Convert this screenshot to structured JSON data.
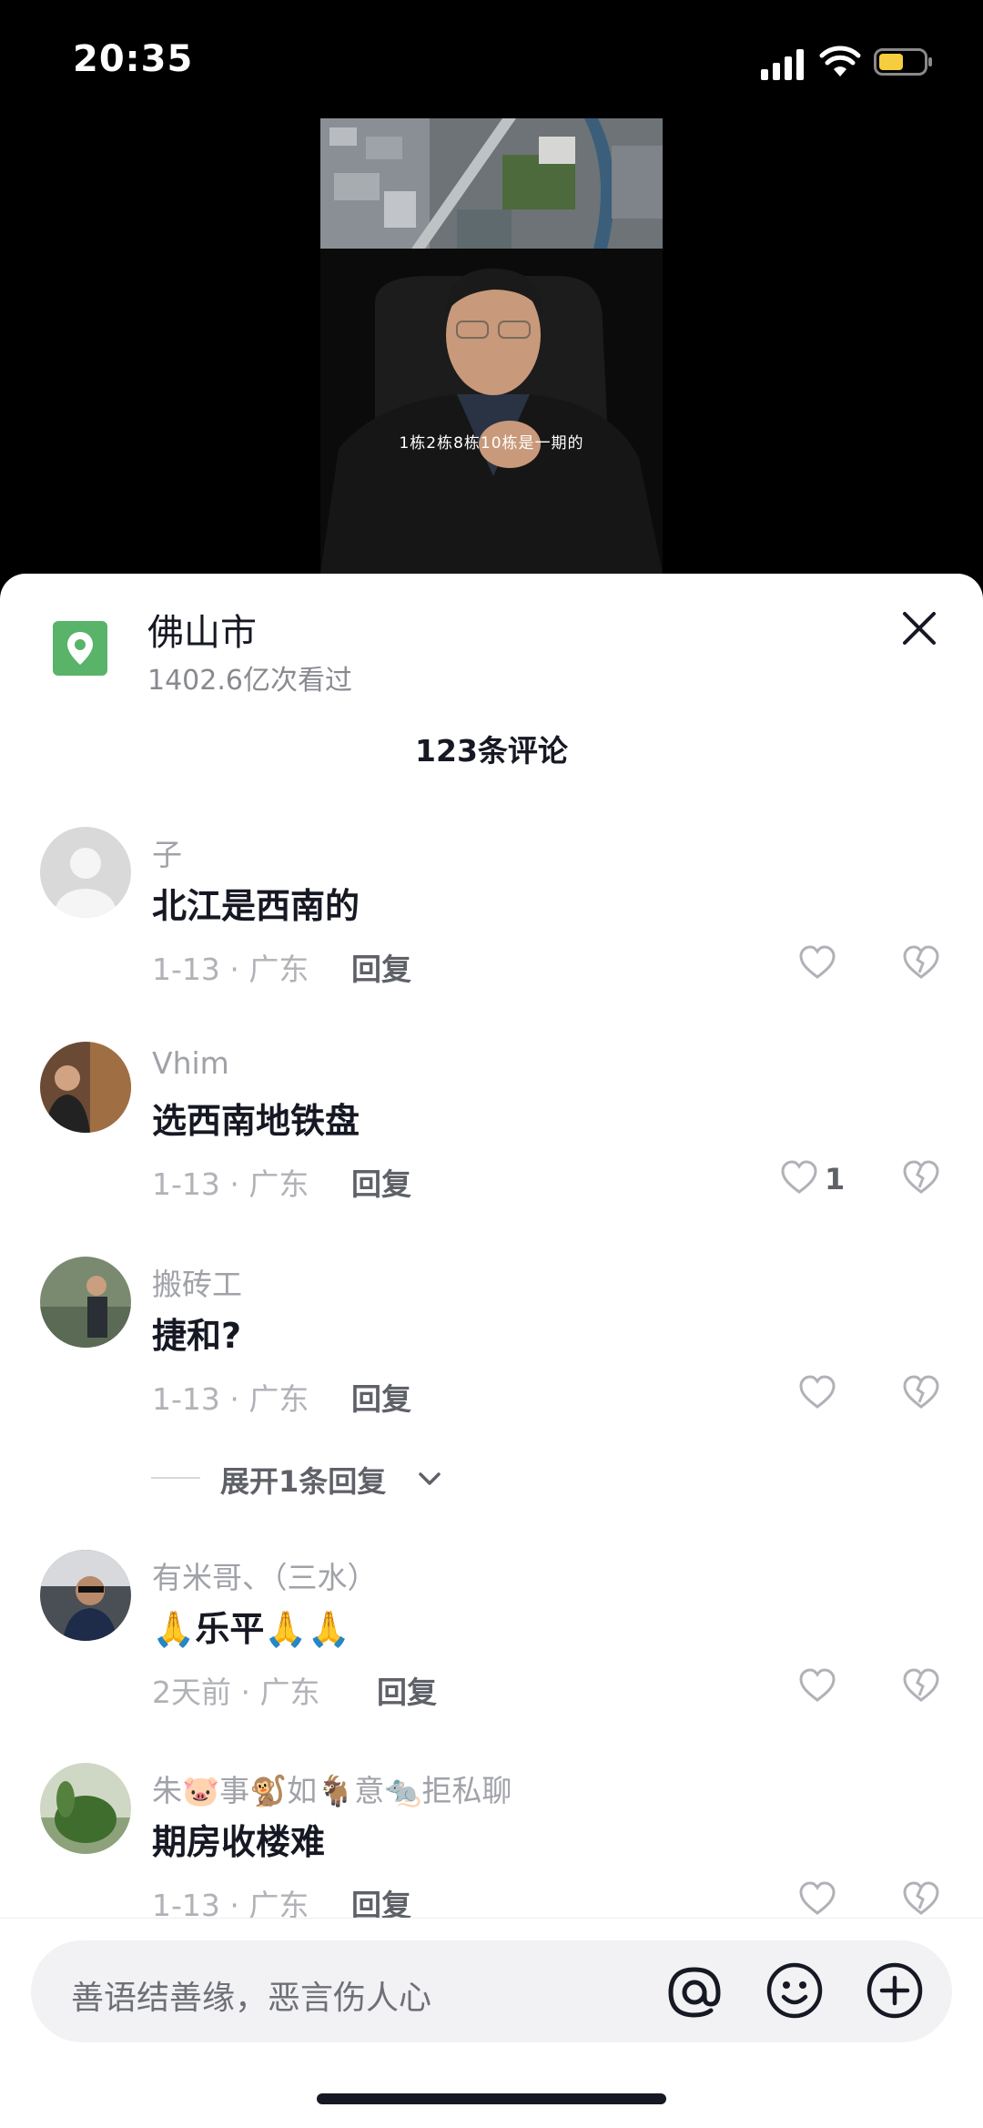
{
  "status_bar": {
    "time": "20:35",
    "battery_color": "#f5cd3e"
  },
  "video": {
    "subtitle": "1栋2栋8栋10栋是一期的"
  },
  "location": {
    "name": "佛山市",
    "views": "1402.6亿次看过",
    "icon": "location-pin-icon",
    "icon_color": "#59b368"
  },
  "comments_header": {
    "count_label": "123条评论"
  },
  "comments": [
    {
      "username": "子",
      "text": "北江是西南的",
      "meta": "1-13 · 广东",
      "reply": "回复",
      "likes": ""
    },
    {
      "username": "Vhim",
      "text": "选西南地铁盘",
      "meta": "1-13 · 广东",
      "reply": "回复",
      "likes": "1"
    },
    {
      "username": "搬砖工",
      "text": "捷和?",
      "meta": "1-13 · 广东",
      "reply": "回复",
      "likes": ""
    },
    {
      "username": "有米哥、（三水）",
      "text": "🙏乐平🙏🙏",
      "meta": "2天前 · 广东",
      "reply": "回复",
      "likes": ""
    },
    {
      "username": "朱🐷事🐒如🐐意🐀拒私聊",
      "text": "期房收楼难",
      "meta": "1-13 · 广东",
      "reply": "回复",
      "likes": ""
    }
  ],
  "expand_replies": {
    "label": "展开1条回复"
  },
  "input": {
    "placeholder": "善语结善缘，恶言伤人心"
  }
}
